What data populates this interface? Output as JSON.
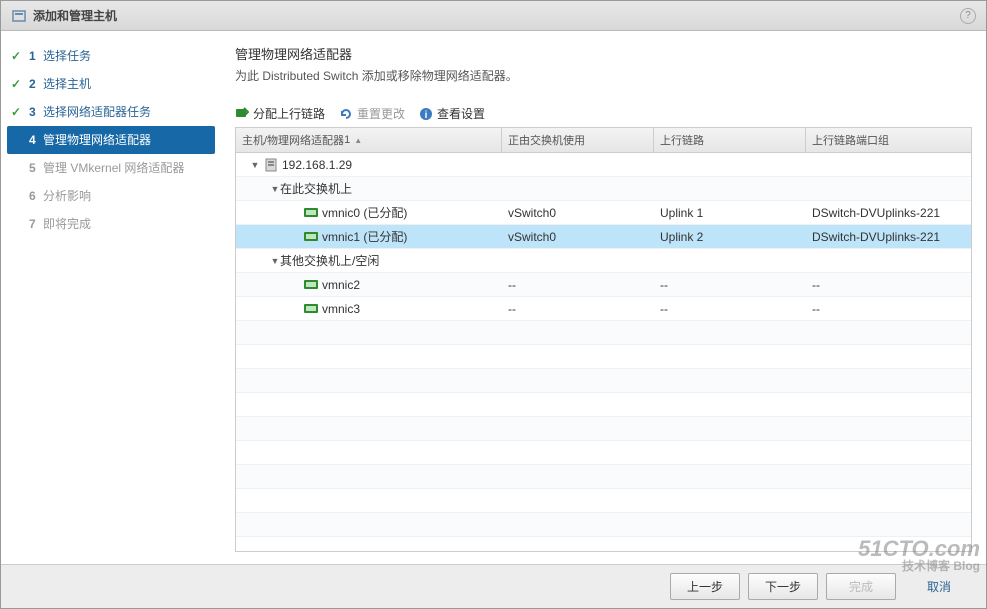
{
  "window": {
    "title": "添加和管理主机"
  },
  "wizard": {
    "steps": [
      {
        "num": "1",
        "label": "选择任务",
        "state": "done"
      },
      {
        "num": "2",
        "label": "选择主机",
        "state": "done"
      },
      {
        "num": "3",
        "label": "选择网络适配器任务",
        "state": "done"
      },
      {
        "num": "4",
        "label": "管理物理网络适配器",
        "state": "current"
      },
      {
        "num": "5",
        "label": "管理 VMkernel 网络适配器",
        "state": "pending"
      },
      {
        "num": "6",
        "label": "分析影响",
        "state": "pending"
      },
      {
        "num": "7",
        "label": "即将完成",
        "state": "pending"
      }
    ]
  },
  "page": {
    "title": "管理物理网络适配器",
    "desc": "为此 Distributed Switch 添加或移除物理网络适配器。"
  },
  "toolbar": {
    "assign": "分配上行链路",
    "reset": "重置更改",
    "view": "查看设置"
  },
  "table": {
    "headers": {
      "col1": "主机/物理网络适配器",
      "sort_indicator": "1",
      "col2": "正由交换机使用",
      "col3": "上行链路",
      "col4": "上行链路端口组"
    },
    "rows": [
      {
        "type": "host",
        "indent": 0,
        "expand": "▼",
        "name": "192.168.1.29",
        "c2": "",
        "c3": "",
        "c4": ""
      },
      {
        "type": "group",
        "indent": 1,
        "expand": "▼",
        "name": "在此交换机上",
        "c2": "",
        "c3": "",
        "c4": ""
      },
      {
        "type": "nic",
        "indent": 2,
        "expand": "",
        "name": "vmnic0 (已分配)",
        "c2": "vSwitch0",
        "c3": "Uplink 1",
        "c4": "DSwitch-DVUplinks-221",
        "selected": false
      },
      {
        "type": "nic",
        "indent": 2,
        "expand": "",
        "name": "vmnic1 (已分配)",
        "c2": "vSwitch0",
        "c3": "Uplink 2",
        "c4": "DSwitch-DVUplinks-221",
        "selected": true
      },
      {
        "type": "group",
        "indent": 1,
        "expand": "▼",
        "name": "其他交换机上/空闲",
        "c2": "",
        "c3": "",
        "c4": ""
      },
      {
        "type": "nic",
        "indent": 2,
        "expand": "",
        "name": "vmnic2",
        "c2": "--",
        "c3": "--",
        "c4": "--"
      },
      {
        "type": "nic",
        "indent": 2,
        "expand": "",
        "name": "vmnic3",
        "c2": "--",
        "c3": "--",
        "c4": "--"
      }
    ]
  },
  "footer": {
    "back": "上一步",
    "next": "下一步",
    "finish": "完成",
    "cancel": "取消"
  },
  "watermark": {
    "line1": "51CTO.com",
    "line2": "技术博客  Blog"
  }
}
